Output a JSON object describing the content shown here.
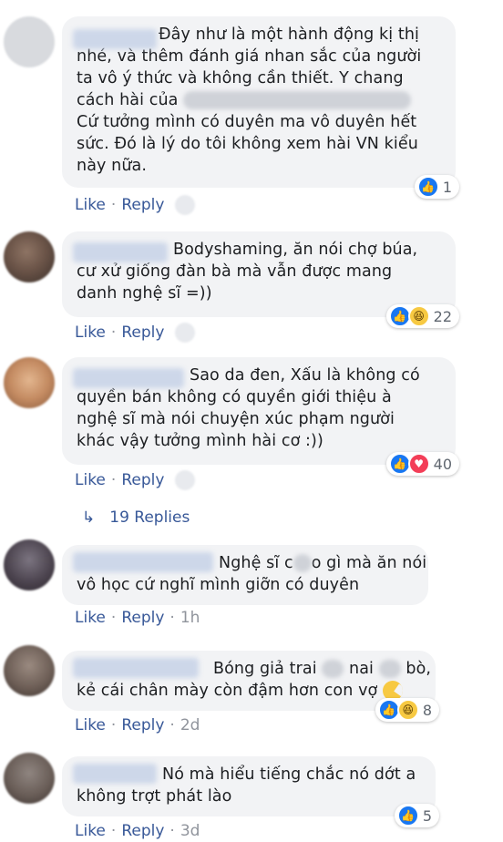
{
  "actions": {
    "like": "Like",
    "reply": "Reply",
    "sep": "·"
  },
  "comments": [
    {
      "lines": [
        "Đây như là một hành động kị thị",
        "nhé, và thêm đánh giá nhan sắc của người",
        "ta vô ý thức và không cần thiết. Y chang",
        "cách hài của",
        "Cứ tưởng mình có duyên ma vô duyên hết",
        "sức. Đó là lý do tôi không xem hài VN kiểu",
        "này nữa."
      ],
      "reactions": "1",
      "time": ""
    },
    {
      "lines": [
        "Bodyshaming, ăn nói chợ búa,",
        "cư xử giống đàn bà mà vẫn được mang",
        "danh nghệ sĩ =))"
      ],
      "reactions": "22",
      "time": ""
    },
    {
      "lines": [
        "Sao da đen, Xấu là không có",
        "quyền bán không có quyền giới thiệu à",
        "nghệ sĩ mà nói chuyện xúc phạm người",
        "khác vậy tưởng mình hài cơ :))"
      ],
      "reactions": "40",
      "time": ""
    },
    {
      "line1_a": "Nghệ sĩ c",
      "line1_b": "o gì mà ăn nói",
      "line2": "vô học cứ nghĩ mình giỡn có duyên",
      "time": "1h"
    },
    {
      "line1_a": "Bóng giả trai",
      "line1_b": "nai",
      "line1_c": "bò,",
      "line2": "kẻ cái chân mày còn đậm hơn con vợ",
      "reactions": "8",
      "time": "2d"
    },
    {
      "lines": [
        "Nó mà hiểu tiếng chắc nó dớt a",
        "không trợt phát lào"
      ],
      "reactions": "5",
      "time": "3d"
    }
  ],
  "replies_label": "19 Replies",
  "replies_arrow": "↳",
  "icons": {
    "like": "like-reaction-icon",
    "haha": "haha-reaction-icon",
    "love": "love-reaction-icon"
  },
  "colors": {
    "link": "#385898",
    "bubble": "#f2f3f5",
    "like_blue": "#1877f2",
    "love_red": "#f33e58",
    "haha_yellow": "#f7c942"
  }
}
